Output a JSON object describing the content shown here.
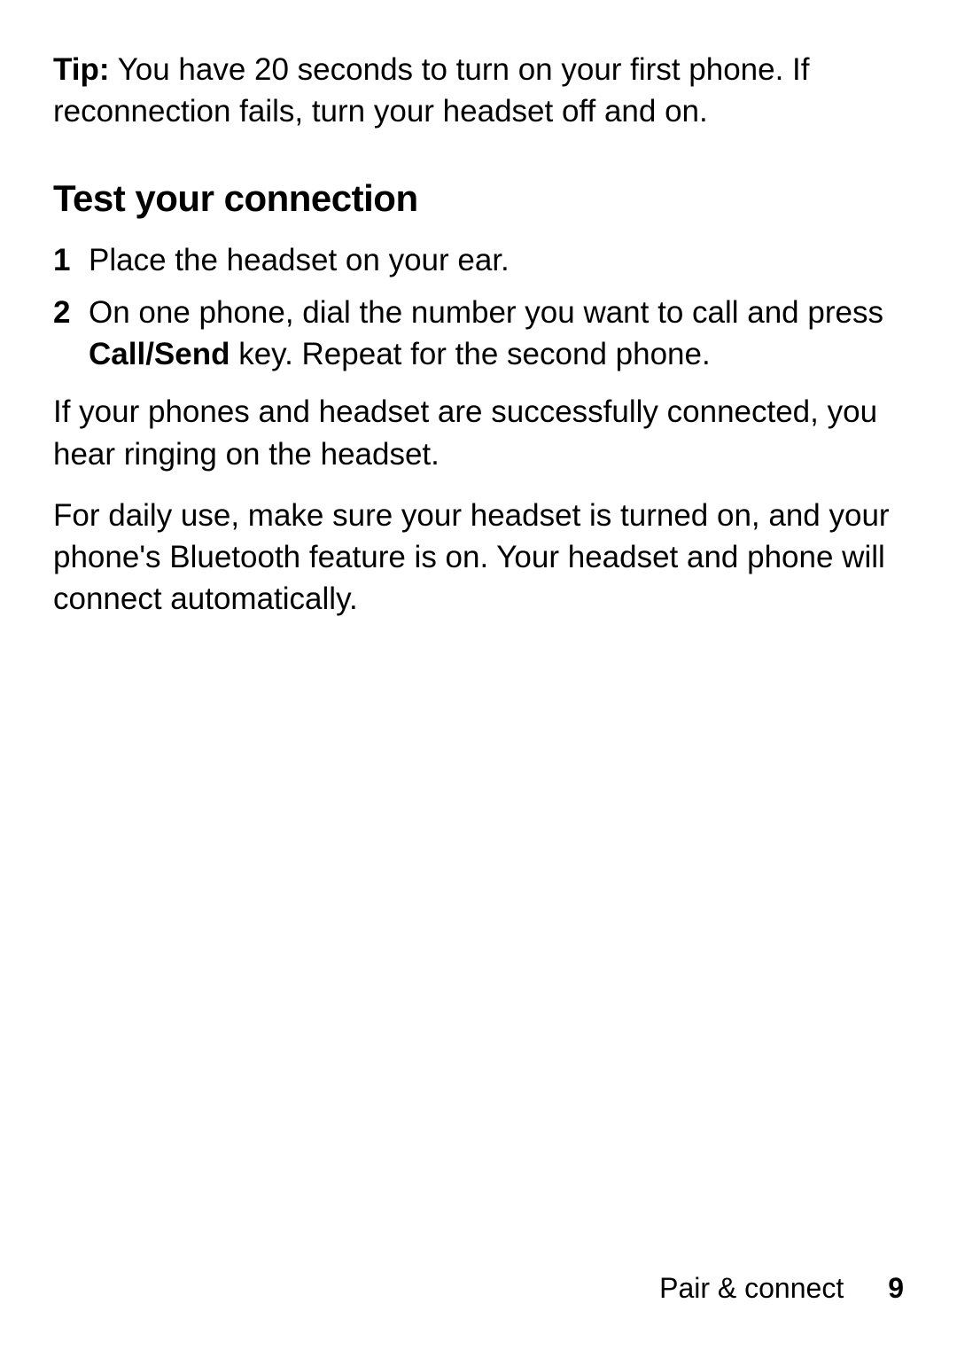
{
  "tip": {
    "label": "Tip:",
    "text": " You have 20 seconds to turn on your first phone. If reconnection fails, turn your headset off and on."
  },
  "heading": "Test your connection",
  "steps": [
    {
      "number": "1",
      "text": "Place the headset on your ear."
    },
    {
      "number": "2",
      "text_before": "On one phone, dial the number you want to call and press ",
      "bold": "Call/Send",
      "text_after": " key. Repeat for the second phone."
    }
  ],
  "paragraphs": [
    "If your phones and headset are successfully connected, you hear ringing on the headset.",
    "For daily use, make sure your headset is turned on, and your phone's Bluetooth feature is on. Your headset and phone will connect automatically."
  ],
  "footer": {
    "section": "Pair & connect",
    "page": "9"
  }
}
